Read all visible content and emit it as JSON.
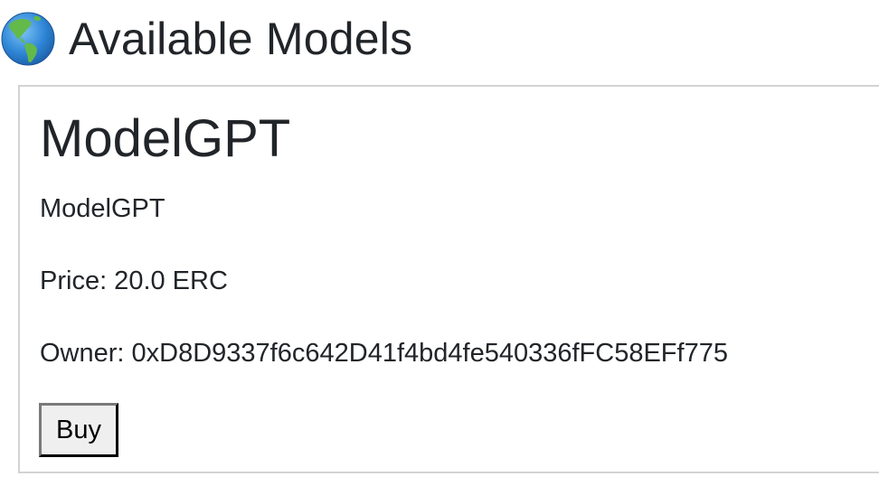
{
  "header": {
    "icon": "globe-americas-icon",
    "title": "Available Models"
  },
  "models": [
    {
      "name": "ModelGPT",
      "description": "ModelGPT",
      "price_text": "Price: 20.0 ERC",
      "owner_text": "Owner: 0xD8D9337f6c642D41f4bd4fe540336fFC58EFf775",
      "buy_label": "Buy"
    }
  ],
  "colors": {
    "text": "#212529",
    "card_border": "#d3d3d3",
    "button_bg": "#efefef",
    "globe_ocean": "#3b8fd9",
    "globe_land": "#5cb85c"
  }
}
